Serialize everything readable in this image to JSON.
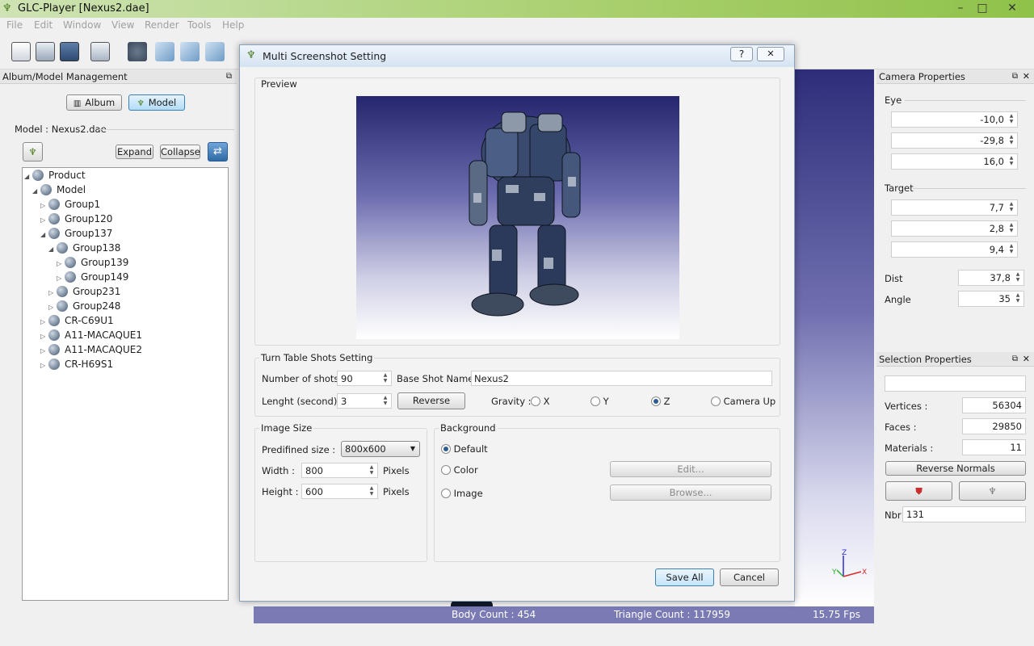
{
  "window": {
    "title": "GLC-Player [Nexus2.dae]",
    "min": "–",
    "max": "□",
    "close": "✕"
  },
  "menu": [
    "File",
    "Edit",
    "Window",
    "View",
    "Render",
    "Tools",
    "Help"
  ],
  "album_panel": {
    "title": "Album/Model Management",
    "album_btn": "Album",
    "model_btn": "Model",
    "model_label": "Model : Nexus2.dae",
    "expand": "Expand",
    "collapse": "Collapse",
    "tree": [
      {
        "label": "Product",
        "level": 0,
        "arrow": "◢"
      },
      {
        "label": "Model",
        "level": 1,
        "arrow": "◢"
      },
      {
        "label": "Group1",
        "level": 2,
        "arrow": "▷"
      },
      {
        "label": "Group120",
        "level": 2,
        "arrow": "▷"
      },
      {
        "label": "Group137",
        "level": 2,
        "arrow": "◢"
      },
      {
        "label": "Group138",
        "level": 3,
        "arrow": "◢"
      },
      {
        "label": "Group139",
        "level": 4,
        "arrow": "▷"
      },
      {
        "label": "Group149",
        "level": 4,
        "arrow": "▷"
      },
      {
        "label": "Group231",
        "level": 3,
        "arrow": "▷"
      },
      {
        "label": "Group248",
        "level": 3,
        "arrow": "▷"
      },
      {
        "label": "CR-C69U1",
        "level": 2,
        "arrow": "▷"
      },
      {
        "label": "A11-MACAQUE1",
        "level": 2,
        "arrow": "▷"
      },
      {
        "label": "A11-MACAQUE2",
        "level": 2,
        "arrow": "▷"
      },
      {
        "label": "CR-H69S1",
        "level": 2,
        "arrow": "▷"
      }
    ]
  },
  "dialog": {
    "title": "Multi Screenshot Setting",
    "help": "?",
    "close": "✕",
    "preview_label": "Preview",
    "turntable_label": "Turn Table Shots Setting",
    "shots_label": "Number of shots :",
    "shots_value": "90",
    "base_label": "Base Shot Name :",
    "base_value": "Nexus2",
    "length_label": "Lenght (second) :",
    "length_value": "3",
    "reverse_btn": "Reverse",
    "gravity_label": "Gravity :",
    "gravity_x": "X",
    "gravity_y": "Y",
    "gravity_z": "Z",
    "gravity_cam": "Camera Up",
    "image_size_label": "Image Size",
    "predef_label": "Predifined size :",
    "predef_value": "800x600",
    "width_label": "Width :",
    "width_value": "800",
    "height_label": "Height :",
    "height_value": "600",
    "pixels": "Pixels",
    "background_label": "Background",
    "bg_default": "Default",
    "bg_color": "Color",
    "bg_image": "Image",
    "edit_btn": "Edit...",
    "browse_btn": "Browse...",
    "save_all": "Save All",
    "cancel": "Cancel"
  },
  "camera_panel": {
    "title": "Camera Properties",
    "eye_label": "Eye",
    "eye": [
      "-10,0",
      "-29,8",
      "16,0"
    ],
    "target_label": "Target",
    "target": [
      "7,7",
      "2,8",
      "9,4"
    ],
    "dist_label": "Dist",
    "dist": "37,8",
    "angle_label": "Angle",
    "angle": "35"
  },
  "selection_panel": {
    "title": "Selection Properties",
    "vertices_label": "Vertices :",
    "vertices": "56304",
    "faces_label": "Faces :",
    "faces": "29850",
    "materials_label": "Materials :",
    "materials": "11",
    "reverse_normals": "Reverse Normals",
    "nbr_label": "Nbr",
    "nbr": "131"
  },
  "status": {
    "body": "Body Count : 454",
    "triangles": "Triangle Count : 117959",
    "fps": "15.75 Fps"
  },
  "colors": {
    "viewport_top": "#2a2a78",
    "viewport_bottom": "#ffffff",
    "status_bg": "#7a7ab4",
    "accent": "#2b5b94"
  }
}
